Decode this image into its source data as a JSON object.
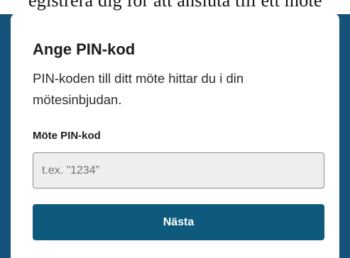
{
  "dialog": {
    "title": "Ange PIN-kod",
    "description": "PIN-koden till ditt möte hittar du i din mötesinbjudan.",
    "pin_label": "Möte PIN-kod",
    "pin_placeholder": "t.ex. ”1234”",
    "pin_value": "",
    "next_label": "Nästa"
  },
  "colors": {
    "background": "#14527a",
    "button": "#0e5a7c",
    "input_background": "#eeeeee"
  }
}
